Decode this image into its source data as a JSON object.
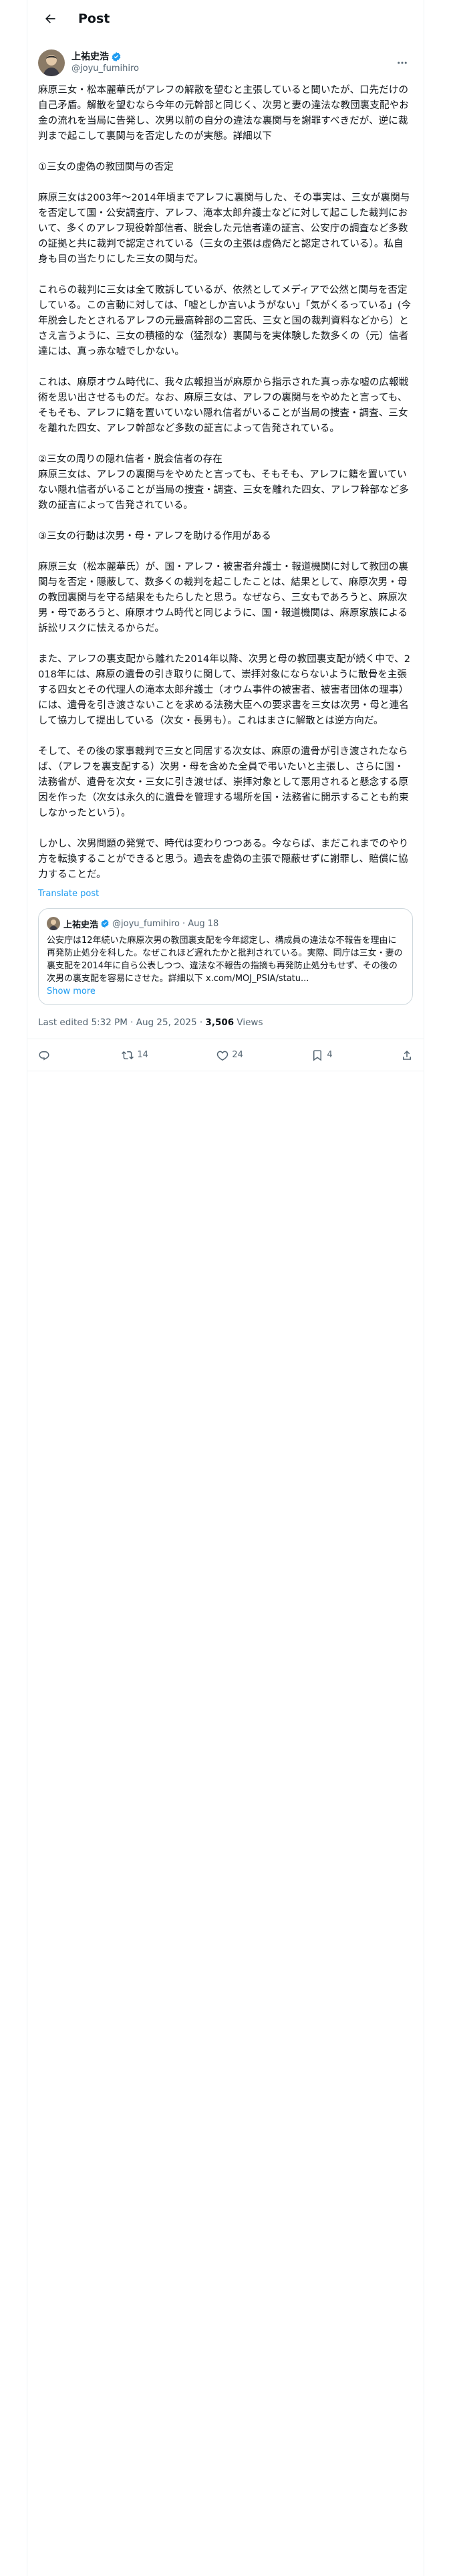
{
  "header": {
    "title": "Post"
  },
  "author": {
    "name": "上祐史浩",
    "handle": "@joyu_fumihiro"
  },
  "post": {
    "paragraphs": [
      "麻原三女・松本麗華氏がアレフの解散を望むと主張していると聞いたが、口先だけの自己矛盾。解散を望むなら今年の元幹部と同じく、次男と妻の違法な教団裏支配やお金の流れを当局に告発し、次男以前の自分の違法な裏関与を謝罪すべきだが、逆に裁判まで起こして裏関与を否定したのが実態。詳細以下",
      "①三女の虚偽の教団関与の否定",
      "麻原三女は2003年〜2014年頃までアレフに裏関与した、その事実は、三女が裏関与を否定して国・公安調査庁、アレフ、滝本太郎弁護士などに対して起こした裁判において、多くのアレフ現役幹部信者、脱会した元信者達の証言、公安庁の調査など多数の証拠と共に裁判で認定されている（三女の主張は虚偽だと認定されている）。私自身も目の当たりにした三女の関与だ。",
      "これらの裁判に三女は全て敗訴しているが、依然としてメディアで公然と関与を否定している。この言動に対しては、「嘘としか言いようがない」「気がくるっている」(今年脱会したとされるアレフの元最高幹部の二宮氏、三女と国の裁判資料などから）とさえ言うように、三女の積極的な（猛烈な）裏関与を実体験した数多くの（元）信者達には、真っ赤な嘘でしかない。",
      "これは、麻原オウム時代に、我々広報担当が麻原から指示された真っ赤な嘘の広報戦術を思い出させるものだ。なお、麻原三女は、アレフの裏関与をやめたと言っても、そもそも、アレフに籍を置いていない隠れ信者がいることが当局の捜査・調査、三女を離れた四女、アレフ幹部など多数の証言によって告発されている。",
      "②三女の周りの隠れ信者・脱会信者の存在\n麻原三女は、アレフの裏関与をやめたと言っても、そもそも、アレフに籍を置いていない隠れ信者がいることが当局の捜査・調査、三女を離れた四女、アレフ幹部など多数の証言によって告発されている。",
      "③三女の行動は次男・母・アレフを助ける作用がある",
      "麻原三女（松本麗華氏）が、国・アレフ・被害者弁護士・報道機関に対して教団の裏関与を否定・隠蔽して、数多くの裁判を起こしたことは、結果として、麻原次男・母の教団裏関与を守る結果をもたらしたと思う。なぜなら、三女もであろうと、麻原次男・母であろうと、麻原オウム時代と同じように、国・報道機関は、麻原家族による訴訟リスクに怯えるからだ。",
      "また、アレフの裏支配から離れた2014年以降、次男と母の教団裏支配が続く中で、2018年には、麻原の遺骨の引き取りに関して、崇拝対象にならないように散骨を主張する四女とその代理人の滝本太郎弁護士（オウム事件の被害者、被害者団体の理事）には、遺骨を引き渡さないことを求める法務大臣への要求書を三女は次男・母と連名して協力して提出している（次女・長男も）。これはまさに解散とは逆方向だ。",
      "そして、その後の家事裁判で三女と同居する次女は、麻原の遺骨が引き渡されたならば、（アレフを裏支配する）次男・母を含めた全員で弔いたいと主張し、さらに国・法務省が、遺骨を次女・三女に引き渡せば、崇拝対象として悪用されると懸念する原因を作った（次女は永久的に遺骨を管理する場所を国・法務省に開示することも約束しなかったという）。",
      "しかし、次男問題の発覚で、時代は変わりつつある。今ならば、まだこれまでのやり方を転換することができると思う。過去を虚偽の主張で隠蔽せずに謝罪し、賠償に協力することだ。"
    ],
    "translate_label": "Translate post",
    "quote": {
      "name": "上祐史浩",
      "handle": "@joyu_fumihiro",
      "date": "· Aug 18",
      "text": "公安庁は12年続いた麻原次男の教団裏支配を今年認定し、構成員の違法な不報告を理由に再発防止処分を科した。なぜこれほど遅れたかと批判されている。実際、同庁は三女・妻の裏支配を2014年に自ら公表しつつ、違法な不報告の指摘も再発防止処分もせず、その後の次男の裏支配を容易にさせた。詳細以下 x.com/MOJ_PSIA/statu...",
      "show_more": "Show more"
    },
    "edited": "Last edited 5:32 PM · Aug 25, 2025 · ",
    "views_count": "3,506",
    "views_label": " Views"
  },
  "actions": {
    "reply": "",
    "repost": "14",
    "like": "24",
    "bookmark": "4"
  },
  "colors": {
    "accent": "#1d9bf0",
    "text": "#0f1419",
    "muted": "#536471",
    "border": "#eff3f4"
  }
}
